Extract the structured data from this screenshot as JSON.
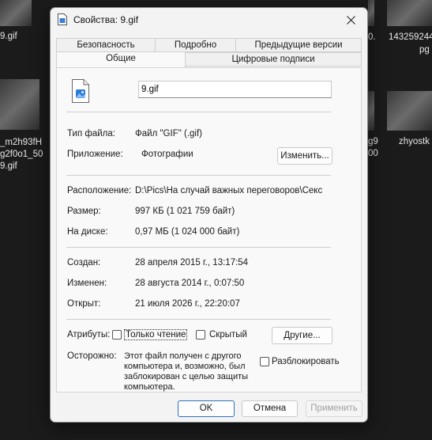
{
  "background": {
    "left_labels": [
      "9.gif",
      "_m2h93fH",
      "g2f0o1_50",
      "9.gif"
    ],
    "right_labels": [
      "0.",
      "143259244",
      "pg",
      "g9",
      "00",
      "zhyostk"
    ]
  },
  "dialog": {
    "title": "Свойства: 9.gif",
    "close_icon": "close-icon",
    "tabs_row1": [
      "Безопасность",
      "Подробно",
      "Предыдущие версии"
    ],
    "tabs_row2": [
      "Общие",
      "Цифровые подписи"
    ],
    "active_tab": "Общие",
    "file_name": "9.gif",
    "file_type_label": "Тип файла:",
    "file_type_value": "Файл \"GIF\" (.gif)",
    "app_label": "Приложение:",
    "app_value": "Фотографии",
    "change_button": "Изменить...",
    "location_label": "Расположение:",
    "location_value": "D:\\Pics\\На случай важных переговоров\\Секс",
    "size_label": "Размер:",
    "size_value": "997 КБ (1 021 759 байт)",
    "disk_label": "На диске:",
    "disk_value": "0,97 МБ (1 024 000 байт)",
    "created_label": "Создан:",
    "created_value": "28 апреля 2015 г., 13:17:54",
    "modified_label": "Изменен:",
    "modified_value": "28 августа 2014 г., 0:07:50",
    "opened_label": "Открыт:",
    "opened_value": "21 июля 2026 г., 22:20:07",
    "attributes_label": "Атрибуты:",
    "readonly_label": "Только чтение",
    "hidden_label": "Скрытый",
    "other_button": "Другие...",
    "warning_label": "Осторожно:",
    "warning_text": "Этот файл получен с другого компьютера и, возможно, был заблокирован с целью защиты компьютера.",
    "unblock_label": "Разблокировать",
    "ok_button": "OK",
    "cancel_button": "Отмена",
    "apply_button": "Применить"
  }
}
